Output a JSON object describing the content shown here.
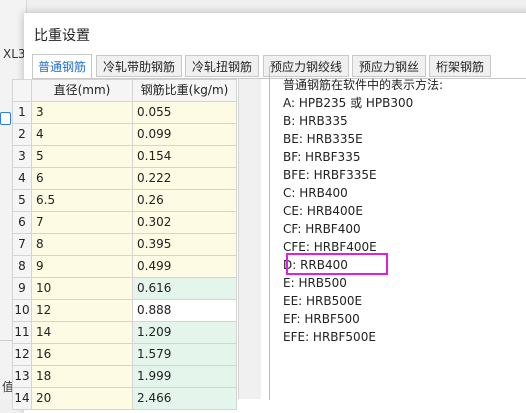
{
  "background": {
    "sheet_label": "XL3",
    "bottom_label": "值"
  },
  "dialog": {
    "title": "比重设置",
    "tabs": [
      {
        "label": "普通钢筋",
        "active": true
      },
      {
        "label": "冷轧带肋钢筋",
        "active": false
      },
      {
        "label": "冷轧扭钢筋",
        "active": false
      },
      {
        "label": "预应力钢绞线",
        "active": false
      },
      {
        "label": "预应力钢丝",
        "active": false
      },
      {
        "label": "桁架钢筋",
        "active": false
      }
    ],
    "table": {
      "headers": {
        "diameter": "直径(mm)",
        "weight": "钢筋比重(kg/m)"
      },
      "rows": [
        {
          "num": "1",
          "diameter": "3",
          "weight": "0.055"
        },
        {
          "num": "2",
          "diameter": "4",
          "weight": "0.099"
        },
        {
          "num": "3",
          "diameter": "5",
          "weight": "0.154"
        },
        {
          "num": "4",
          "diameter": "6",
          "weight": "0.222"
        },
        {
          "num": "5",
          "diameter": "6.5",
          "weight": "0.26"
        },
        {
          "num": "6",
          "diameter": "7",
          "weight": "0.302"
        },
        {
          "num": "7",
          "diameter": "8",
          "weight": "0.395"
        },
        {
          "num": "8",
          "diameter": "9",
          "weight": "0.499"
        },
        {
          "num": "9",
          "diameter": "10",
          "weight": "0.616"
        },
        {
          "num": "10",
          "diameter": "12",
          "weight": "0.888"
        },
        {
          "num": "11",
          "diameter": "14",
          "weight": "1.209"
        },
        {
          "num": "12",
          "diameter": "16",
          "weight": "1.579"
        },
        {
          "num": "13",
          "diameter": "18",
          "weight": "1.999"
        },
        {
          "num": "14",
          "diameter": "20",
          "weight": "2.466"
        }
      ]
    },
    "note": {
      "heading": "普通钢筋在软件中的表示方法:",
      "lines": [
        "A:   HPB235 或 HPB300",
        "B:   HRB335",
        "BE:  HRB335E",
        "BF:  HRBF335",
        "BFE: HRBF335E",
        "C:   HRB400",
        "CE:  HRB400E",
        "CF:  HRBF400",
        "CFE: HRBF400E",
        "D:   RRB400",
        "E:   HRB500",
        "EE:  HRB500E",
        "EF:  HRBF500",
        "EFE: HRBF500E"
      ]
    }
  }
}
